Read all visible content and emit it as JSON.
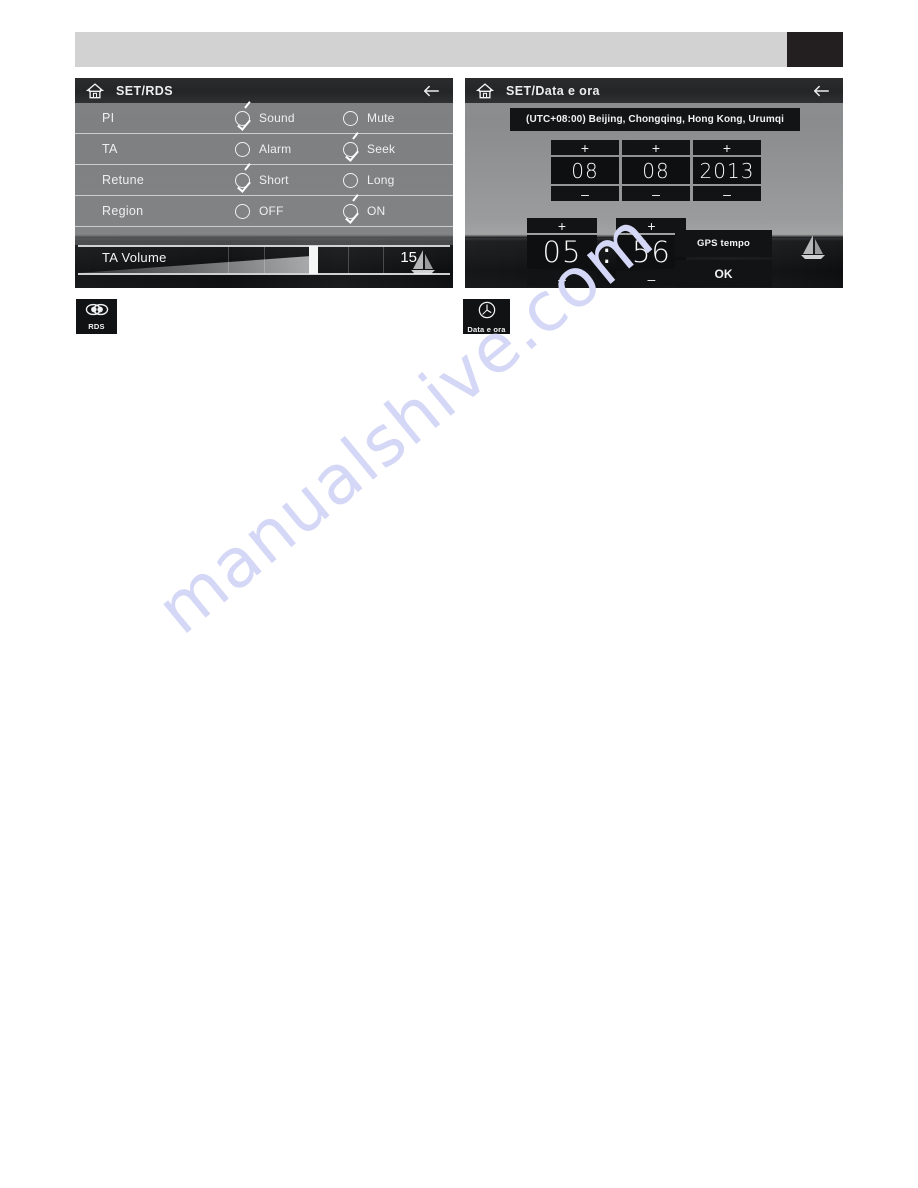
{
  "watermark": {
    "text": "manualshive.com"
  },
  "screens": {
    "rds": {
      "titlebar": {
        "home_icon": "home-icon",
        "title": "SET/RDS",
        "back_icon": "back-arrow-icon"
      },
      "rows": [
        {
          "label": "PI",
          "options": [
            {
              "text": "Sound",
              "checked": true
            },
            {
              "text": "Mute",
              "checked": false
            }
          ]
        },
        {
          "label": "TA",
          "options": [
            {
              "text": "Alarm",
              "checked": false
            },
            {
              "text": "Seek",
              "checked": true
            }
          ]
        },
        {
          "label": "Retune",
          "options": [
            {
              "text": "Short",
              "checked": true
            },
            {
              "text": "Long",
              "checked": false
            }
          ]
        },
        {
          "label": "Region",
          "options": [
            {
              "text": "OFF",
              "checked": false
            },
            {
              "text": "ON",
              "checked": true
            }
          ]
        }
      ],
      "slider": {
        "label": "TA Volume",
        "value": "15",
        "percent": 64
      }
    },
    "datetime": {
      "titlebar": {
        "home_icon": "home-icon",
        "title": "SET/Data e ora",
        "back_icon": "back-arrow-icon"
      },
      "timezone": "(UTC+08:00) Beijing, Chongqing, Hong Kong, Urumqi",
      "increment_label": "+",
      "decrement_label": "–",
      "date": {
        "day": "08",
        "month": "08",
        "year": "2013"
      },
      "time": {
        "hours": "05",
        "separator": ":",
        "minutes": "56"
      },
      "buttons": {
        "gps_tempo": "GPS tempo",
        "ok": "OK"
      }
    }
  },
  "legend": {
    "rds": {
      "icon": "rds-logo-icon",
      "caption": "RDS"
    },
    "datetime": {
      "icon": "clock-icon",
      "caption": "Data e ora"
    }
  },
  "colors": {
    "page_band": "#d2d2d2",
    "page_block": "#231f20",
    "titlebar": "#242526",
    "panel_text": "#efefef",
    "button_bg": "#121314",
    "watermark": "#d4d7f5"
  }
}
